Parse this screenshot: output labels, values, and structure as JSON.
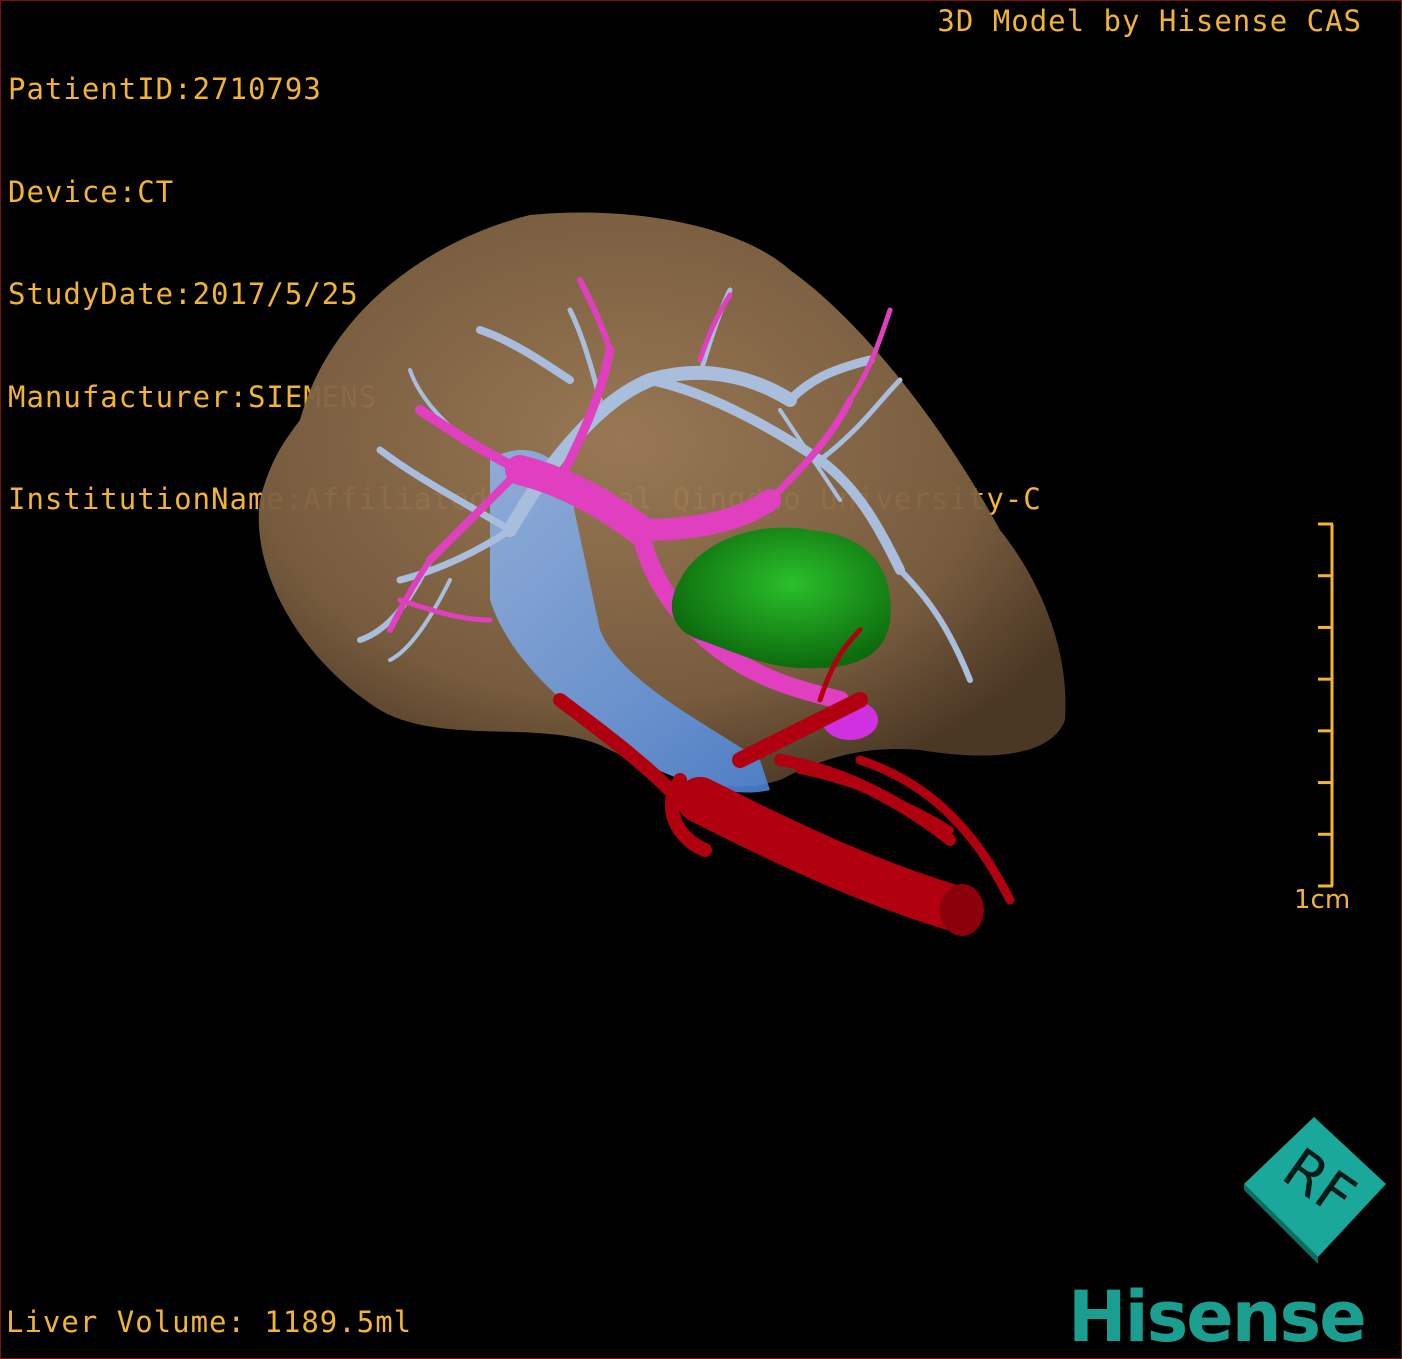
{
  "header": {
    "patient_id": "PatientID:2710793",
    "device": "Device:CT",
    "study_date": "StudyDate:2017/5/25",
    "manufacturer": "Manufacturer:SIEMENS",
    "institution": "InstitutionName:Affiliated Hospital Qingdao University-C"
  },
  "brand": {
    "model_credit": "3D Model by Hisense CAS",
    "logo_text": "Hisense"
  },
  "footer": {
    "liver_volume": "Liver Volume: 1189.5ml"
  },
  "scale_bar": {
    "label": "1cm",
    "tick_count": 8
  },
  "orientation_cube": {
    "face_letters": "RF"
  },
  "colors": {
    "overlay_text": "#f2b431",
    "liver": "#8a6a47",
    "portal_vein": "#e040c0",
    "hepatic_vein": "#9fb4d4",
    "ivc": "#6aa0e8",
    "artery": "#b00010",
    "tumor": "#1ea01e",
    "logo": "#1a9e8f",
    "orientation_cube": "#1aa89a"
  }
}
